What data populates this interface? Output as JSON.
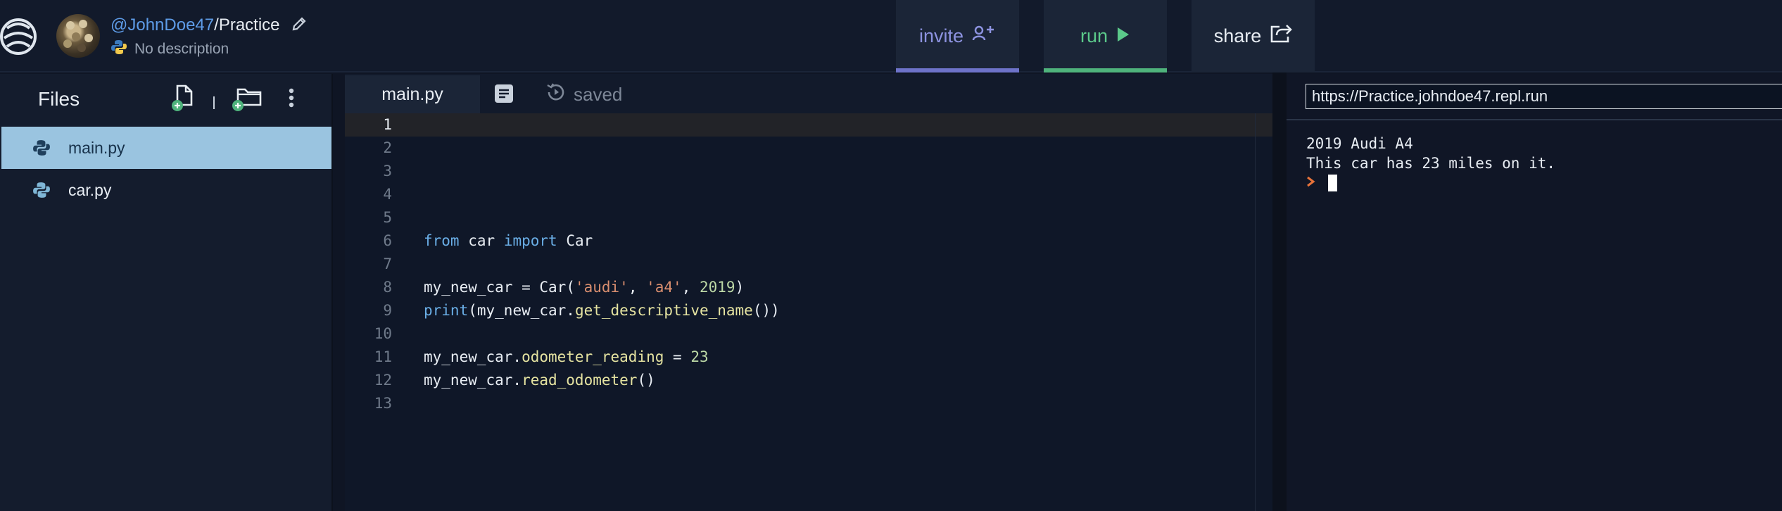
{
  "header": {
    "username": "@JohnDoe47",
    "separator": "/",
    "repl_name": "Practice",
    "description": "No description",
    "buttons": {
      "invite_label": "invite",
      "run_label": "run",
      "share_label": "share"
    },
    "colors": {
      "invite": "#6e73c9",
      "run": "#4fb37c",
      "link": "#5e9ce8"
    }
  },
  "files": {
    "title": "Files",
    "items": [
      {
        "name": "main.py",
        "selected": true
      },
      {
        "name": "car.py",
        "selected": false
      }
    ]
  },
  "editor": {
    "tab_label": "main.py",
    "status": "saved",
    "active_line": "1",
    "line_numbers": [
      "1",
      "2",
      "3",
      "4",
      "5",
      "6",
      "7",
      "8",
      "9",
      "10",
      "11",
      "12",
      "13"
    ],
    "code": {
      "l6_from": "from",
      "l6_mod": "car",
      "l6_import": "import",
      "l6_cls": "Car",
      "l8_var": "my_new_car",
      "l8_eq": " = ",
      "l8_call": "Car",
      "l8_open": "(",
      "l8_a1": "'audi'",
      "l8_c1": ", ",
      "l8_a2": "'a4'",
      "l8_c2": ", ",
      "l8_a3": "2019",
      "l8_close": ")",
      "l9_print": "print",
      "l9_open": "(",
      "l9_obj": "my_new_car.",
      "l9_method": "get_descriptive_name",
      "l9_close": "())",
      "l11_obj": "my_new_car.",
      "l11_attr": "odometer_reading",
      "l11_eq": " = ",
      "l11_val": "23",
      "l12_obj": "my_new_car.",
      "l12_method": "read_odometer",
      "l12_close": "()"
    }
  },
  "console": {
    "url": "https://Practice.johndoe47.repl.run",
    "output": [
      "2019 Audi A4",
      "This car has 23 miles on it."
    ]
  }
}
